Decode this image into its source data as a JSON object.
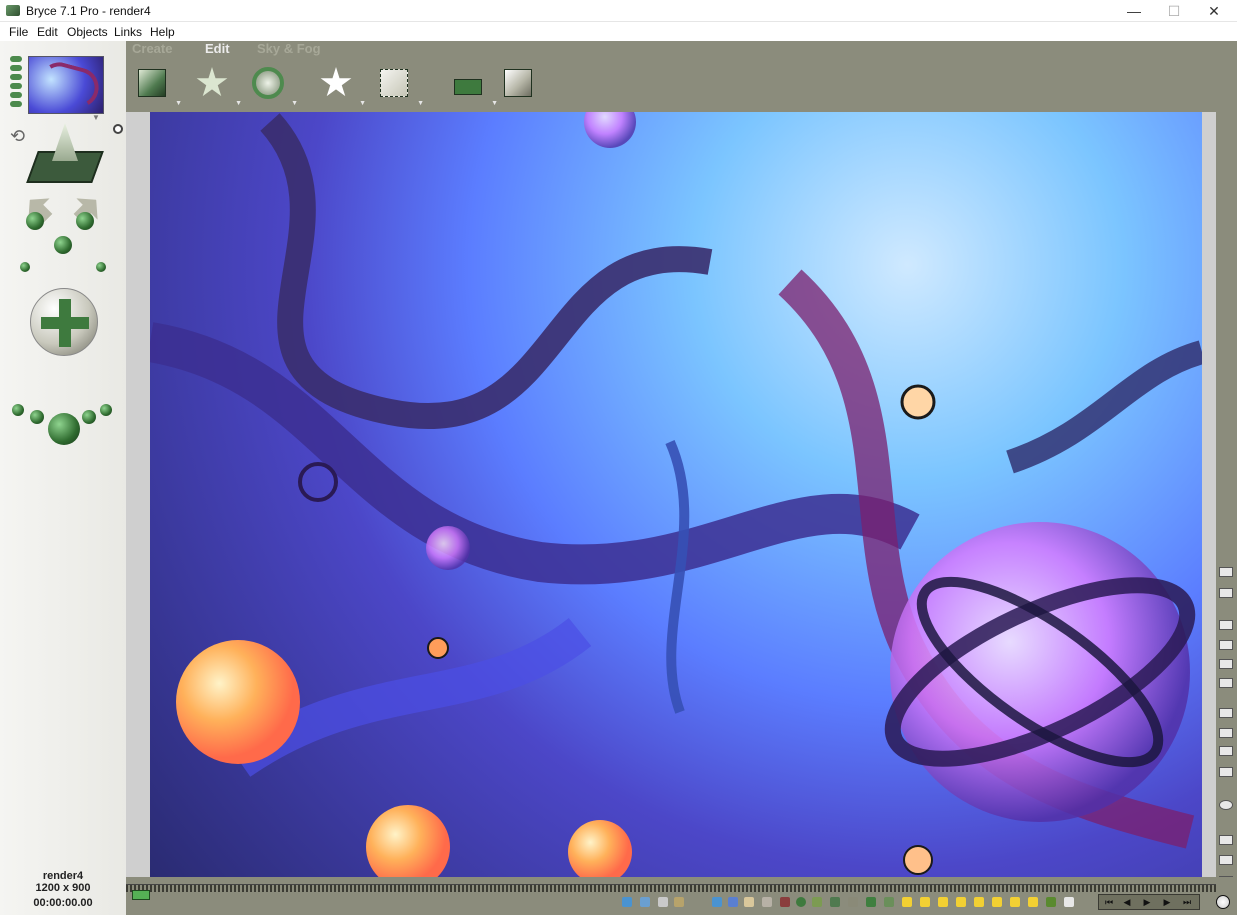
{
  "window": {
    "title": "Bryce 7.1  Pro - render4",
    "minimize_glyph": "—",
    "maximize_glyph": "☐",
    "close_glyph": "✕"
  },
  "menu": {
    "items": [
      "File",
      "Edit",
      "Objects",
      "Links",
      "Help"
    ]
  },
  "palette": {
    "tabs": [
      {
        "label": "Create",
        "active": false
      },
      {
        "label": "Edit",
        "active": true
      },
      {
        "label": "Sky & Fog",
        "active": false
      }
    ],
    "tools": [
      "material-lab-cube-icon",
      "resize-icon",
      "rotate-icon",
      "reposition-icon",
      "align-icon",
      "randomize-icon",
      "terrain-editor-icon"
    ]
  },
  "render_info": {
    "name": "render4",
    "size": "1200 x 900",
    "time": "00:00:00.00"
  },
  "colors": {
    "workspace": "#8b8c7c",
    "panel_light": "#f2f2ee",
    "accent_green": "#3e7a3e",
    "tab_active": "#ececec",
    "tab_inactive": "#a7a898"
  }
}
